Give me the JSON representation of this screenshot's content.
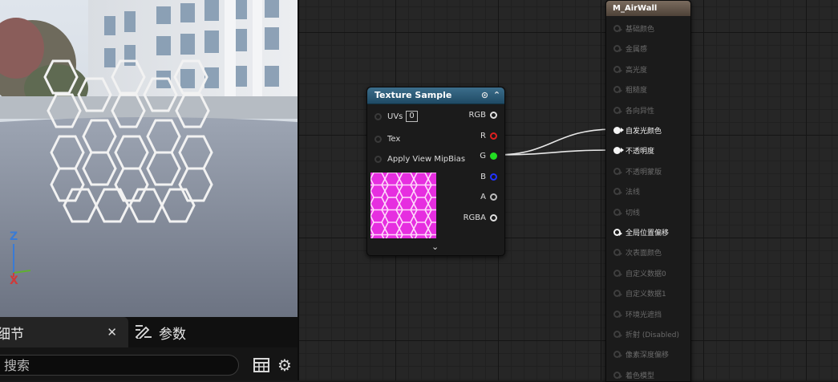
{
  "viewport": {
    "axis_z": "Z",
    "axis_x": "X"
  },
  "details_panel": {
    "tabs": [
      {
        "label": "细节",
        "close": "✕"
      },
      {
        "label": "参数",
        "icon": "edit-params-icon"
      }
    ],
    "search_placeholder": "搜索",
    "search_value": ""
  },
  "texture_node": {
    "title": "Texture Sample",
    "inputs": [
      {
        "label": "UVs",
        "value": "0"
      },
      {
        "label": "Tex"
      },
      {
        "label": "Apply View MipBias"
      }
    ],
    "outputs": [
      {
        "label": "RGB",
        "color": "#e0e0e0"
      },
      {
        "label": "R",
        "color": "#e02020"
      },
      {
        "label": "G",
        "color": "#22dd22"
      },
      {
        "label": "B",
        "color": "#2233ff"
      },
      {
        "label": "A",
        "color": "#bdbdbd"
      },
      {
        "label": "RGBA",
        "color": "#e0e0e0"
      }
    ],
    "preview_color": "#e62ee0"
  },
  "material_node": {
    "title": "M_AirWall",
    "inputs": [
      {
        "label": "基础颜色",
        "state": "off"
      },
      {
        "label": "金属感",
        "state": "off"
      },
      {
        "label": "高光度",
        "state": "off"
      },
      {
        "label": "粗糙度",
        "state": "off"
      },
      {
        "label": "各向异性",
        "state": "off"
      },
      {
        "label": "自发光颜色",
        "state": "connected"
      },
      {
        "label": "不透明度",
        "state": "connected"
      },
      {
        "label": "不透明蒙版",
        "state": "off"
      },
      {
        "label": "法线",
        "state": "off"
      },
      {
        "label": "切线",
        "state": "off"
      },
      {
        "label": "全局位置偏移",
        "state": "enabled"
      },
      {
        "label": "次表面颜色",
        "state": "off"
      },
      {
        "label": "自定义数据0",
        "state": "off"
      },
      {
        "label": "自定义数据1",
        "state": "off"
      },
      {
        "label": "环境光遮挡",
        "state": "off"
      },
      {
        "label": "折射 (Disabled)",
        "state": "off"
      },
      {
        "label": "像素深度偏移",
        "state": "off"
      },
      {
        "label": "着色模型",
        "state": "off"
      }
    ]
  },
  "colors": {
    "accent_texture_header": "#2f5e7a",
    "material_header": "#6e5f52",
    "graph_background": "#262626",
    "wire": "#e8e8e8"
  }
}
